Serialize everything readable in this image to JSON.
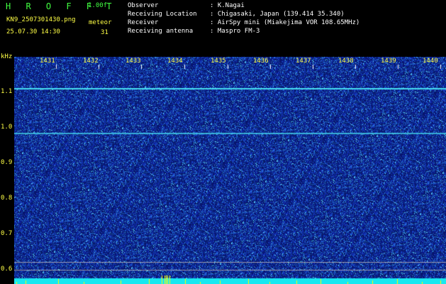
{
  "header": {
    "app_title": "H R O F F T",
    "version": "1.00f",
    "file_name": "KN9_2507301430.png",
    "meteor_label": "meteor",
    "date_time": "25.07.30 14:30",
    "meteor_count": "31"
  },
  "info": [
    {
      "key": "Observer",
      "sep": ":",
      "value": "K.Nagai"
    },
    {
      "key": "Receiving Location",
      "sep": ":",
      "value": "Chigasaki, Japan (139.414 35.340)"
    },
    {
      "key": "Receiver",
      "sep": ":",
      "value": "AirSpy mini (Miakejima VOR 108.65MHz)"
    },
    {
      "key": "Receiving antenna",
      "sep": ":",
      "value": "Maspro FM-3"
    }
  ],
  "axis": {
    "unit": "kHz",
    "y_ticks": [
      "1.1",
      "1.0",
      "0.9",
      "0.8",
      "0.7",
      "0.6"
    ],
    "x_ticks": [
      "1431",
      "1432",
      "1433",
      "1434",
      "1435",
      "1436",
      "1437",
      "1438",
      "1439",
      "1440"
    ]
  },
  "colors": {
    "text_green": "#41ff41",
    "text_yellow": "#ffff45",
    "text_white": "#ffffff",
    "background": "#000000",
    "noise_blue": "#1a2d9c",
    "trace_cyan": "#46dcf0",
    "marker_yellow": "#ffff00"
  }
}
